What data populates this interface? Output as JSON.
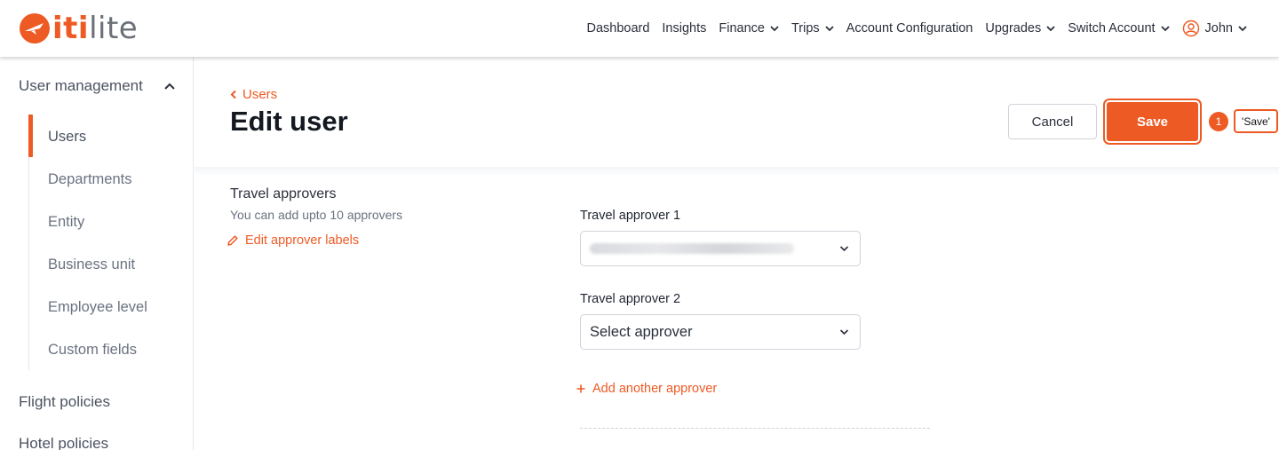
{
  "brand": {
    "logo_text_accent": "iti",
    "logo_text_rest": "lite",
    "accent_color": "#ee5a24"
  },
  "nav": {
    "items": [
      {
        "label": "Dashboard",
        "dropdown": false
      },
      {
        "label": "Insights",
        "dropdown": false
      },
      {
        "label": "Finance",
        "dropdown": true
      },
      {
        "label": "Trips",
        "dropdown": true
      },
      {
        "label": "Account Configuration",
        "dropdown": false
      },
      {
        "label": "Upgrades",
        "dropdown": true
      },
      {
        "label": "Switch Account",
        "dropdown": true
      }
    ],
    "user_name": "John"
  },
  "sidebar": {
    "section_user_management": "User management",
    "items": [
      {
        "label": "Users",
        "active": true
      },
      {
        "label": "Departments"
      },
      {
        "label": "Entity"
      },
      {
        "label": "Business unit"
      },
      {
        "label": "Employee level"
      },
      {
        "label": "Custom fields"
      }
    ],
    "section_flight": "Flight policies",
    "section_hotel": "Hotel policies"
  },
  "header": {
    "breadcrumb": "Users",
    "title": "Edit user",
    "cancel_label": "Cancel",
    "save_label": "Save"
  },
  "annotation": {
    "marker_number": "1",
    "marker_label": "'Save'"
  },
  "approvers": {
    "title": "Travel approvers",
    "subtitle": "You can add upto 10 approvers",
    "edit_labels": "Edit approver labels",
    "fields": [
      {
        "label": "Travel approver 1",
        "value": ""
      },
      {
        "label": "Travel approver 2",
        "value": "Select approver"
      }
    ],
    "add_another": "Add another approver"
  }
}
